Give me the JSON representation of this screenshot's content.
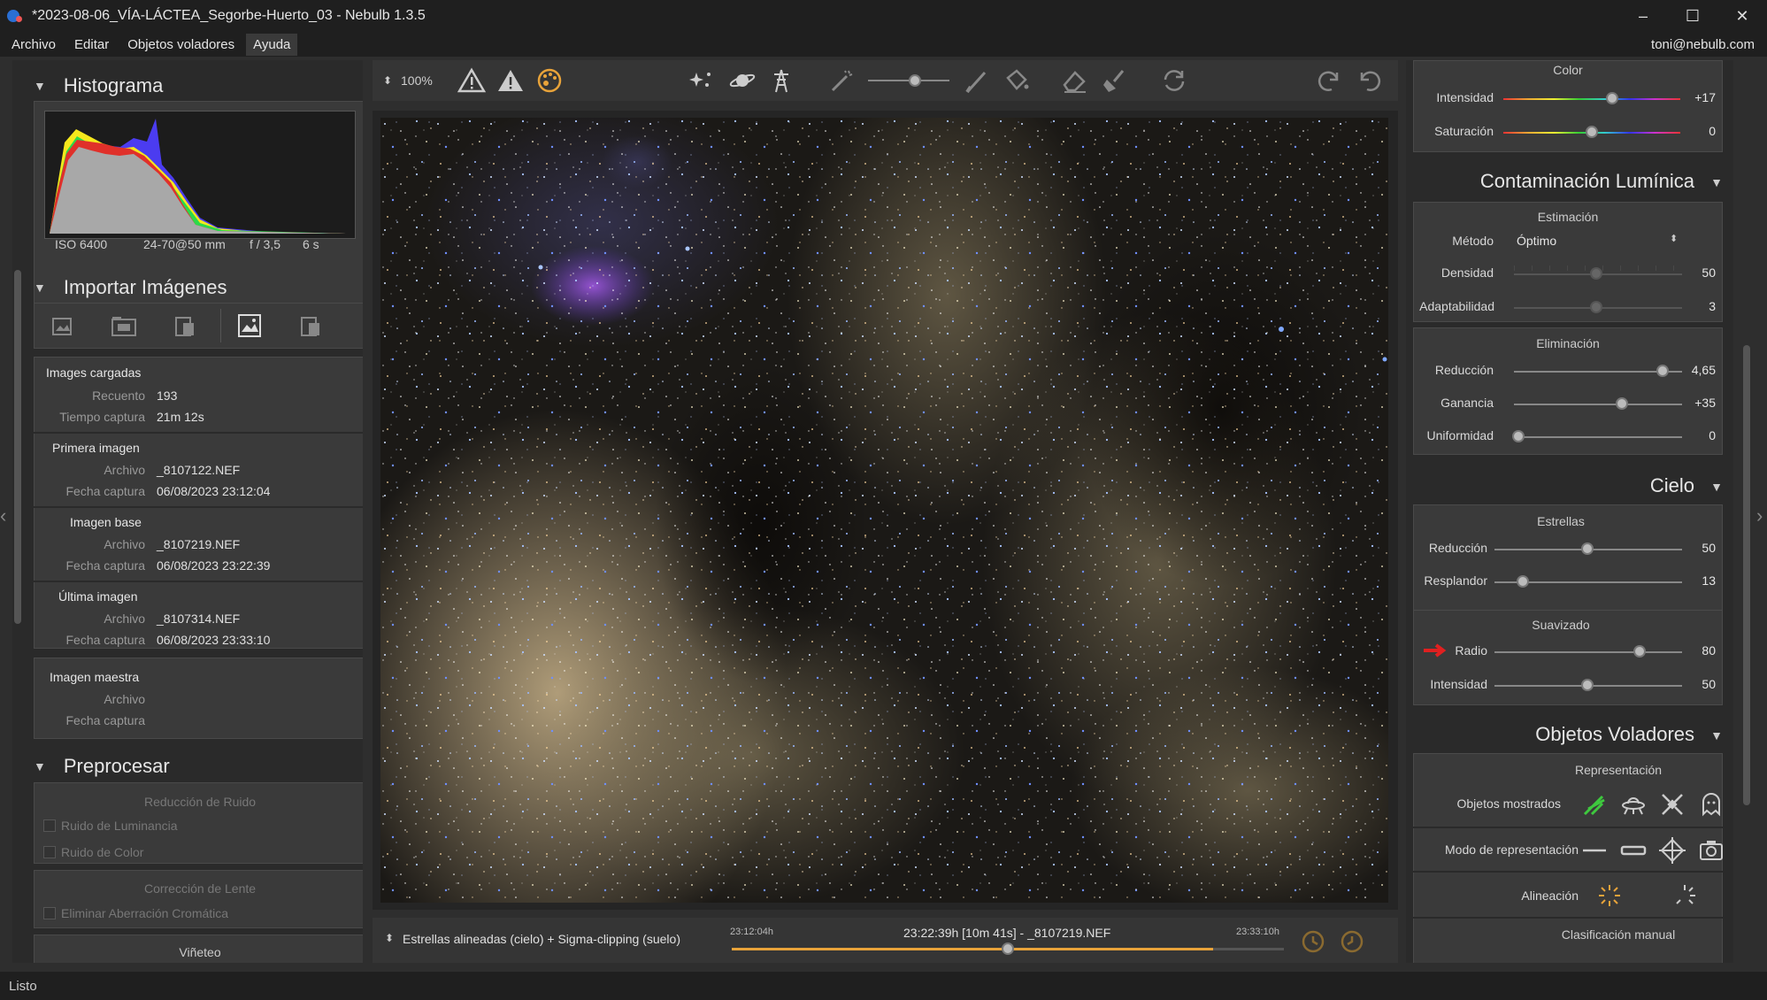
{
  "window": {
    "title": "*2023-08-06_VÍA-LÁCTEA_Segorbe-Huerto_03 - Nebulb 1.3.5",
    "minimize": "–",
    "maximize": "☐",
    "close": "✕"
  },
  "menu": {
    "items": [
      "Archivo",
      "Editar",
      "Objetos voladores",
      "Ayuda"
    ],
    "user": "toni@nebulb.com"
  },
  "histogram": {
    "title": "Histograma",
    "iso": "ISO 6400",
    "lens": "24-70@50 mm",
    "aperture": "f / 3,5",
    "exposure": "6 s"
  },
  "import": {
    "title": "Importar Imágenes",
    "loaded": {
      "title": "Images cargadas",
      "count_label": "Recuento",
      "count": "193",
      "time_label": "Tiempo captura",
      "time": "21m 12s"
    },
    "first": {
      "title": "Primera imagen",
      "file_label": "Archivo",
      "file": "_8107122.NEF",
      "date_label": "Fecha captura",
      "date": "06/08/2023 23:12:04"
    },
    "base": {
      "title": "Imagen base",
      "file_label": "Archivo",
      "file": "_8107219.NEF",
      "date_label": "Fecha captura",
      "date": "06/08/2023 23:22:39"
    },
    "last": {
      "title": "Última imagen",
      "file_label": "Archivo",
      "file": "_8107314.NEF",
      "date_label": "Fecha captura",
      "date": "06/08/2023 23:33:10"
    },
    "master": {
      "title": "Imagen maestra",
      "file_label": "Archivo",
      "date_label": "Fecha captura"
    }
  },
  "preprocess": {
    "title": "Preprocesar",
    "noise_title": "Reducción de Ruido",
    "lum": "Ruido de Luminancia",
    "color": "Ruido de Color",
    "lens_title": "Corrección de Lente",
    "chrom": "Eliminar Aberración Cromática",
    "vignette": "Viñeteo"
  },
  "toolbar": {
    "zoom": "100%"
  },
  "bottom": {
    "mode": "Estrellas alineadas (cielo) + Sigma-clipping (suelo)",
    "start": "23:12:04h",
    "current": "23:22:39h [10m 41s] - _8107219.NEF",
    "end": "23:33:10h",
    "progress": 0.5
  },
  "color": {
    "title": "Color",
    "intensity_label": "Intensidad",
    "intensity": "+17",
    "saturation_label": "Saturación",
    "saturation": "0"
  },
  "lightpollution": {
    "title": "Contaminación Lumínica",
    "estimation": "Estimación",
    "method_label": "Método",
    "method": "Óptimo",
    "density_label": "Densidad",
    "density": "50",
    "adapt_label": "Adaptabilidad",
    "adapt": "3",
    "elimination": "Eliminación",
    "reduction_label": "Reducción",
    "reduction": "4,65",
    "gain_label": "Ganancia",
    "gain": "+35",
    "uniform_label": "Uniformidad",
    "uniform": "0"
  },
  "sky": {
    "title": "Cielo",
    "stars": "Estrellas",
    "reduction_label": "Reducción",
    "reduction": "50",
    "glow_label": "Resplandor",
    "glow": "13",
    "smoothing": "Suavizado",
    "radius_label": "Radio",
    "radius": "80",
    "intensity_label": "Intensidad",
    "intensity": "50"
  },
  "flying": {
    "title": "Objetos Voladores",
    "representation": "Representación",
    "shown_label": "Objetos mostrados",
    "mode_label": "Modo de representación",
    "align_label": "Alineación",
    "manual": "Clasificación manual"
  },
  "status": {
    "text": "Listo"
  },
  "colors": {
    "accent": "#e8a33a",
    "red_arrow": "#e02020"
  }
}
